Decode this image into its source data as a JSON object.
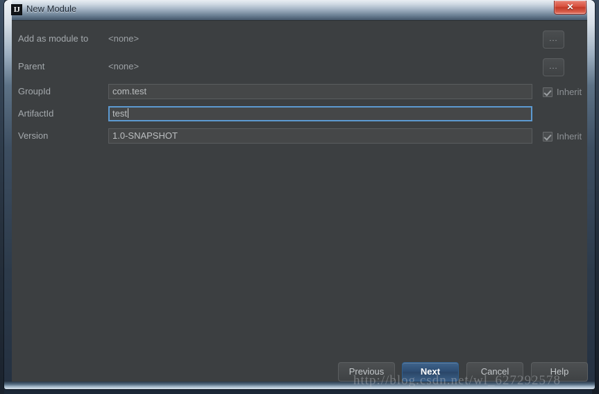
{
  "window": {
    "title": "New Module",
    "app_icon": "IJ",
    "close_label": "✕"
  },
  "form": {
    "rows": [
      {
        "label": "Add as module to",
        "value": "<none>",
        "type": "plain",
        "browse": "...",
        "inherit": null
      },
      {
        "label": "Parent",
        "value": "<none>",
        "type": "plain",
        "browse": "...",
        "inherit": null
      },
      {
        "label": "GroupId",
        "value": "com.test",
        "type": "field",
        "browse": null,
        "inherit": "Inherit"
      },
      {
        "label": "ArtifactId",
        "value": "test",
        "type": "field-focused",
        "browse": null,
        "inherit": null
      },
      {
        "label": "Version",
        "value": "1.0-SNAPSHOT",
        "type": "field",
        "browse": null,
        "inherit": "Inherit"
      }
    ]
  },
  "buttons": {
    "previous": "Previous",
    "next": "Next",
    "cancel": "Cancel",
    "help": "Help"
  },
  "watermark": {
    "text": "http://blog.csdn.net/wl_627292578"
  },
  "colors": {
    "dialog_background": "#3c3f41",
    "field_background": "#454748",
    "focus_border": "#5c9ad2",
    "default_button": "#2e4d72",
    "label_text": "#a4a9ad",
    "close_button": "#c23a28"
  }
}
